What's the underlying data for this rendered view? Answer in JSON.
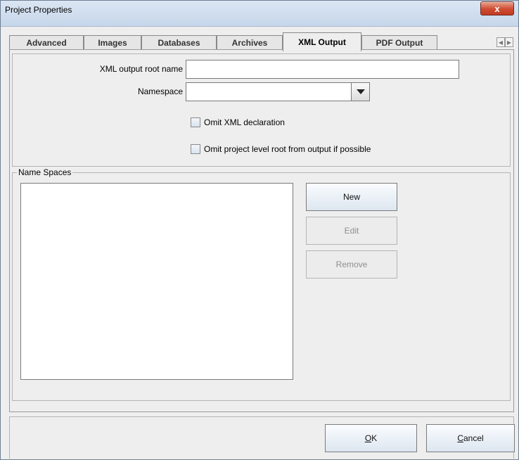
{
  "window": {
    "title": "Project Properties",
    "close_glyph": "x"
  },
  "tabs": [
    {
      "label": "Advanced",
      "active": false
    },
    {
      "label": "Images",
      "active": false
    },
    {
      "label": "Databases",
      "active": false
    },
    {
      "label": "Archives",
      "active": false
    },
    {
      "label": "XML Output",
      "active": true
    },
    {
      "label": "PDF Output",
      "active": false
    }
  ],
  "tab_scroll": {
    "left_glyph": "◀",
    "right_glyph": "▶"
  },
  "xml_output": {
    "root_name_label": "XML output root name",
    "root_name_value": "",
    "namespace_label": "Namespace",
    "namespace_value": "",
    "omit_declaration_label": "Omit XML declaration",
    "omit_declaration_checked": false,
    "omit_root_label": "Omit project level root from output if possible",
    "omit_root_checked": false
  },
  "name_spaces": {
    "group_title": "Name Spaces",
    "items": [],
    "new_label": "New",
    "edit_label": "Edit",
    "remove_label": "Remove"
  },
  "footer": {
    "ok_mnemonic": "O",
    "ok_rest": "K",
    "cancel_mnemonic": "C",
    "cancel_rest": "ancel"
  },
  "colors": {
    "window_bg": "#eeeeee",
    "titlebar": "#c6d6ea",
    "close_button": "#cf4b31"
  }
}
